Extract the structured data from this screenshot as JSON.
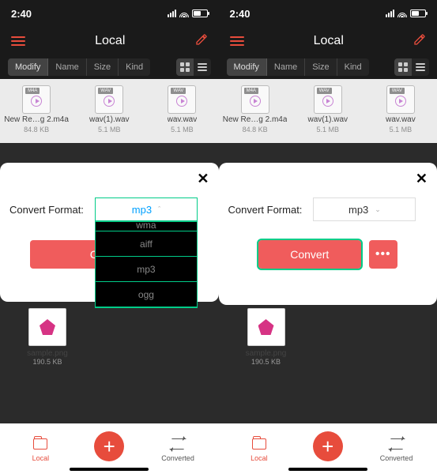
{
  "status": {
    "time": "2:40"
  },
  "nav": {
    "title": "Local"
  },
  "sort": {
    "modify": "Modify",
    "name": "Name",
    "size": "Size",
    "kind": "Kind"
  },
  "files": [
    {
      "name": "New Re…g 2.m4a",
      "size": "84.8 KB",
      "badge": "M4A"
    },
    {
      "name": "wav(1).wav",
      "size": "5.1 MB",
      "badge": "WAV"
    },
    {
      "name": "wav.wav",
      "size": "5.1 MB",
      "badge": "WAV"
    }
  ],
  "modal": {
    "label": "Convert Format:",
    "selected": "mp3",
    "options": {
      "wma": "wma",
      "aiff": "aiff",
      "mp3": "mp3",
      "ogg": "ogg"
    },
    "convert": "Convert",
    "more": "•••"
  },
  "sample": {
    "name": "sample.png",
    "size": "190.5 KB"
  },
  "tabs": {
    "local": "Local",
    "converted": "Converted"
  },
  "close": "✕",
  "plus": "+"
}
